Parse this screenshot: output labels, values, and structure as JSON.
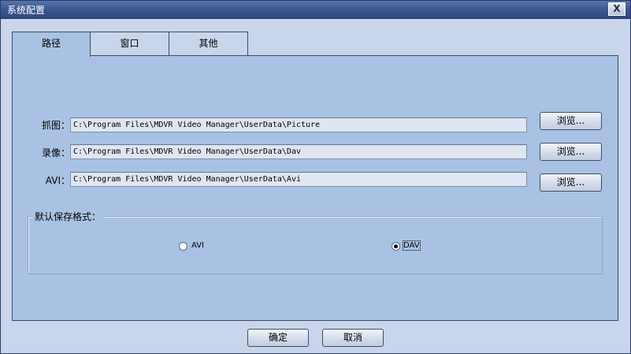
{
  "window": {
    "title": "系统配置",
    "close_glyph": "X"
  },
  "tabs": [
    {
      "label": "路径",
      "active": true
    },
    {
      "label": "窗口",
      "active": false
    },
    {
      "label": "其他",
      "active": false
    }
  ],
  "paths": [
    {
      "label": "抓图：",
      "value": "C:\\Program Files\\MDVR Video Manager\\UserData\\Picture",
      "browse_label": "浏览..."
    },
    {
      "label": "录像：",
      "value": "C:\\Program Files\\MDVR Video Manager\\UserData\\Dav",
      "browse_label": "浏览..."
    },
    {
      "label": "AVI：",
      "value": "C:\\Program Files\\MDVR Video Manager\\UserData\\Avi",
      "browse_label": "浏览..."
    }
  ],
  "default_format": {
    "label": "默认保存格式：",
    "options": [
      {
        "label": "AVI",
        "selected": false
      },
      {
        "label": "DAV",
        "selected": true
      }
    ]
  },
  "footer": {
    "ok_label": "确定",
    "cancel_label": "取消"
  }
}
